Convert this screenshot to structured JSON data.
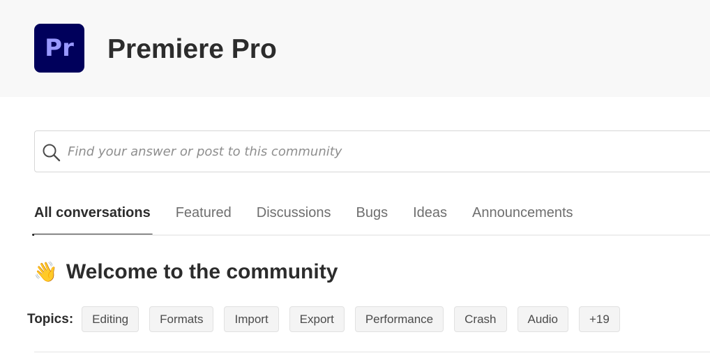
{
  "app": {
    "icon_text": "Pr",
    "title": "Premiere Pro",
    "icon_bg_color": "#00005b",
    "icon_text_color": "#9999ff"
  },
  "search": {
    "placeholder": "Find your answer or post to this community",
    "value": ""
  },
  "tabs": [
    {
      "label": "All conversations",
      "active": true
    },
    {
      "label": "Featured",
      "active": false
    },
    {
      "label": "Discussions",
      "active": false
    },
    {
      "label": "Bugs",
      "active": false
    },
    {
      "label": "Ideas",
      "active": false
    },
    {
      "label": "Announcements",
      "active": false
    }
  ],
  "welcome": {
    "icon": "waving-hand-icon",
    "emoji": "👋",
    "title": "Welcome to the community"
  },
  "topics": {
    "label": "Topics:",
    "chips": [
      "Editing",
      "Formats",
      "Import",
      "Export",
      "Performance",
      "Crash",
      "Audio",
      "+19"
    ]
  }
}
